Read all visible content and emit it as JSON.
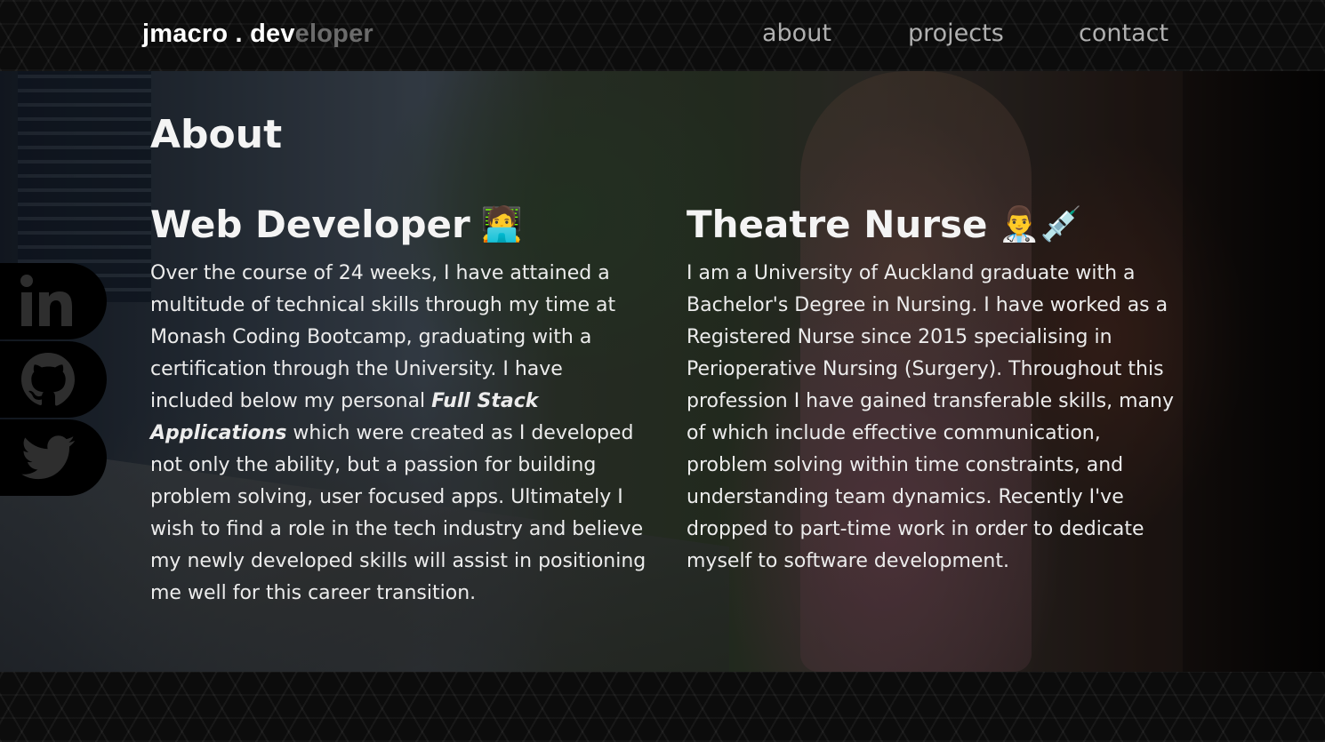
{
  "header": {
    "brand_lit": "jmacro . dev",
    "brand_dim": "eloper",
    "nav": {
      "about": "about",
      "projects": "projects",
      "contact": "contact"
    }
  },
  "about": {
    "title": "About",
    "web": {
      "heading": "Web Developer",
      "emoji": "🧑‍💻",
      "body_before": "Over the course of 24 weeks, I have attained a multitude of technical skills through my time at Monash Coding Bootcamp, graduating with a certification through the University. I have included below my personal ",
      "body_emphasis": "Full Stack Applications",
      "body_after": " which were created as I developed not only the ability, but a passion for building problem solving, user focused apps. Ultimately I wish to find a role in the tech industry and believe my newly developed skills will assist in positioning me well for this career transition."
    },
    "nurse": {
      "heading": "Theatre Nurse",
      "emoji": "👨‍⚕️💉",
      "body": "I am a University of Auckland graduate with a Bachelor's Degree in Nursing. I have worked as a Registered Nurse since 2015 specialising in Perioperative Nursing (Surgery). Throughout this profession I have gained transferable skills, many of which include effective communication, problem solving within time constraints, and understanding team dynamics. Recently I've dropped to part-time work in order to dedicate myself to software development."
    }
  },
  "social": {
    "icons": [
      "linkedin-icon",
      "github-icon",
      "twitter-icon"
    ]
  },
  "colors": {
    "background": "#0c0c0c",
    "brand_dim": "#6b6b6b",
    "nav_text": "#b0b0b0",
    "social_icon": "#2e2e2e"
  }
}
